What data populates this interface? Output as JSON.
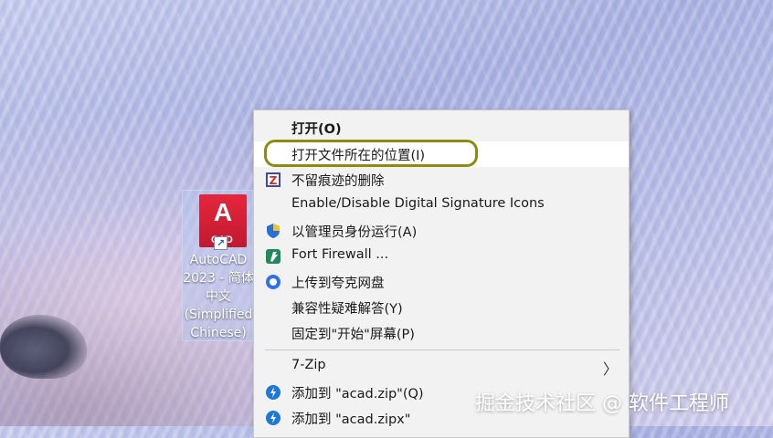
{
  "desktop_icon": {
    "logo_letter": "A",
    "logo_text": "CAD",
    "label_lines": [
      "AutoCAD",
      "2023 - 简体",
      "中文",
      "(Simplified",
      "Chinese)"
    ]
  },
  "context_menu": {
    "items": [
      {
        "label": "打开(O)",
        "icon": "none",
        "bold": true
      },
      {
        "label": "打开文件所在的位置(I)",
        "icon": "none",
        "highlighted": true
      },
      {
        "label": "不留痕迹的删除",
        "icon": "winrar-z-icon"
      },
      {
        "label": "Enable/Disable Digital Signature Icons",
        "icon": "none"
      },
      {
        "label": "以管理员身份运行(A)",
        "icon": "uac-shield-icon"
      },
      {
        "label": "Fort Firewall ...",
        "icon": "fort-firewall-icon"
      },
      {
        "label": "上传到夸克网盘",
        "icon": "quark-cloud-icon"
      },
      {
        "label": "兼容性疑难解答(Y)",
        "icon": "none"
      },
      {
        "label": "固定到\"开始\"屏幕(P)",
        "icon": "none"
      },
      {
        "label": "7-Zip",
        "icon": "none",
        "submenu": true
      },
      {
        "label": "添加到 \"acad.zip\"(Q)",
        "icon": "bandizip-icon"
      },
      {
        "label": "添加到 \"acad.zipx\"",
        "icon": "bandizip-icon"
      }
    ]
  },
  "watermark": "掘金技术社区 @ 软件工程师",
  "colors": {
    "menu_bg": "#f2f2f2",
    "highlight_ring": "#8b8d10",
    "autocad_red": "#e5263d"
  }
}
